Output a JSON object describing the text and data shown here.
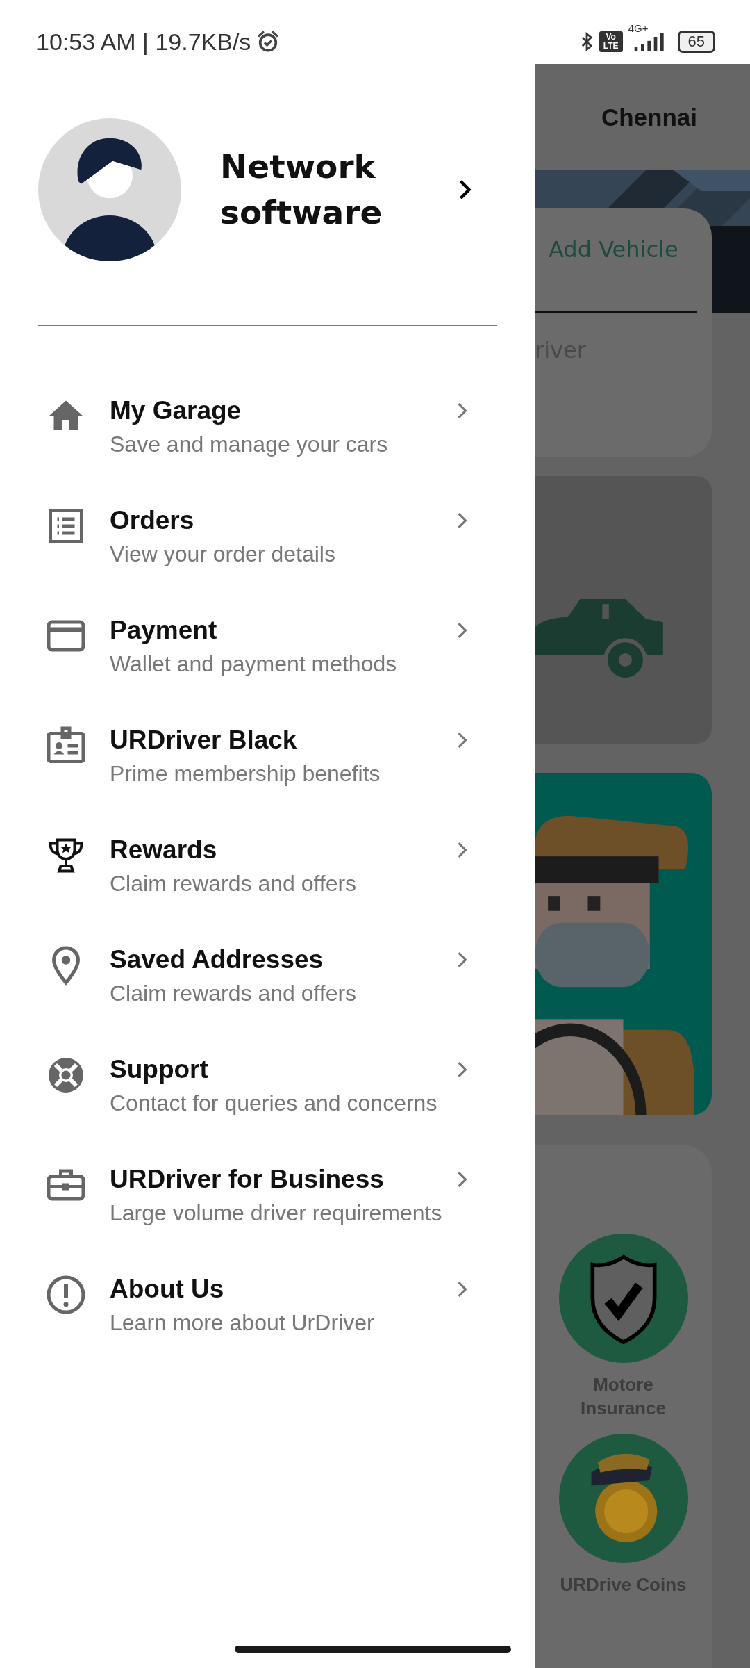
{
  "status_bar": {
    "time_speed": "10:53 AM | 19.7KB/s",
    "volte": "Vo LTE",
    "network": "4G+",
    "battery": "65"
  },
  "profile": {
    "name": "Network software"
  },
  "menu": [
    {
      "kind": "home",
      "title": "My Garage",
      "subtitle": "Save and manage your cars"
    },
    {
      "kind": "list",
      "title": "Orders",
      "subtitle": "View your order details"
    },
    {
      "kind": "card",
      "title": "Payment",
      "subtitle": "Wallet and payment methods"
    },
    {
      "kind": "badge",
      "title": "URDriver Black",
      "subtitle": "Prime membership benefits"
    },
    {
      "kind": "trophy",
      "title": "Rewards",
      "subtitle": "Claim rewards and offers"
    },
    {
      "kind": "pin",
      "title": "Saved Addresses",
      "subtitle": "Claim rewards and offers"
    },
    {
      "kind": "support",
      "title": "Support",
      "subtitle": "Contact for queries and concerns"
    },
    {
      "kind": "briefcase",
      "title": "URDriver for Business",
      "subtitle": "Large volume driver requirements"
    },
    {
      "kind": "info",
      "title": "About Us",
      "subtitle": "Learn more about UrDriver"
    }
  ],
  "background": {
    "city": "Chennai",
    "add_vehicle": "Add Vehicle",
    "partial_text": "river",
    "services": [
      {
        "kind": "shield",
        "label": "Motore Insurance"
      },
      {
        "kind": "coin",
        "label": "URDrive Coins"
      }
    ]
  }
}
